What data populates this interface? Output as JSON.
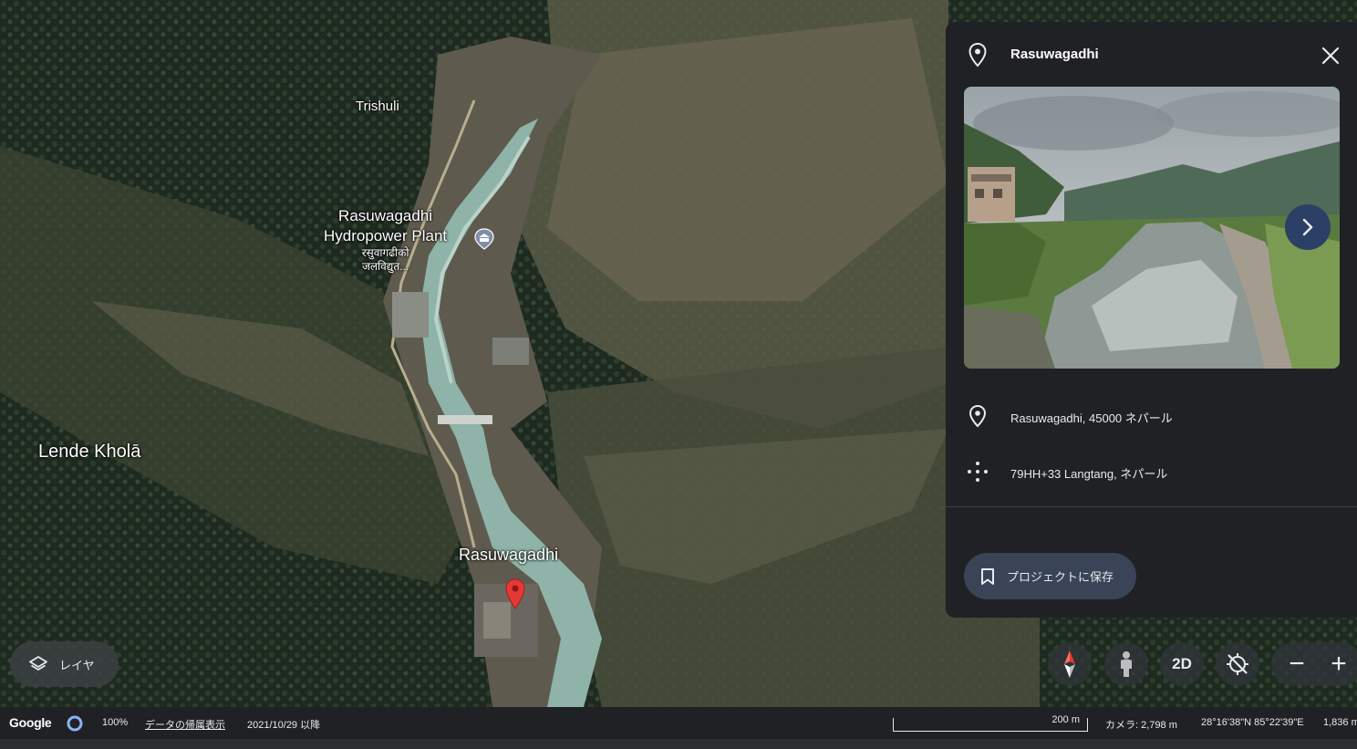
{
  "map": {
    "labels": {
      "trishuli": "Trishuli",
      "plant_line1": "Rasuwagadhi",
      "plant_line2": "Hydropower Plant",
      "plant_np1": "रसुवागढीको",
      "plant_np2": "जलविद्युत...",
      "lende": "Lende Kholā",
      "rasuwagadhi": "Rasuwagadhi"
    },
    "icons": {
      "poi": "museum-icon",
      "pin": "map-pin-icon"
    }
  },
  "panel": {
    "title": "Rasuwagadhi",
    "address": "Rasuwagadhi, 45000 ネパール",
    "plus_code": "79HH+33 Langtang, ネパール",
    "save_label": "プロジェクトに保存"
  },
  "layers": {
    "label": "レイヤ"
  },
  "controls": {
    "two_d_label": "2D",
    "zoom_out": "−",
    "zoom_in": "+"
  },
  "status": {
    "logo": "Google",
    "zoom_percent": "100%",
    "attribution": "データの帰属表示",
    "imagery_date": "2021/10/29 以降",
    "scale_label": "200 m",
    "camera": "カメラ: 2,798 m",
    "coords": "28°16'38\"N 85°22'39\"E",
    "elevation": "1,836 m"
  },
  "colors": {
    "panel_bg": "#202124",
    "save_bg": "#394457",
    "pin_red": "#e53935",
    "next_bg": "#2c3f66"
  }
}
